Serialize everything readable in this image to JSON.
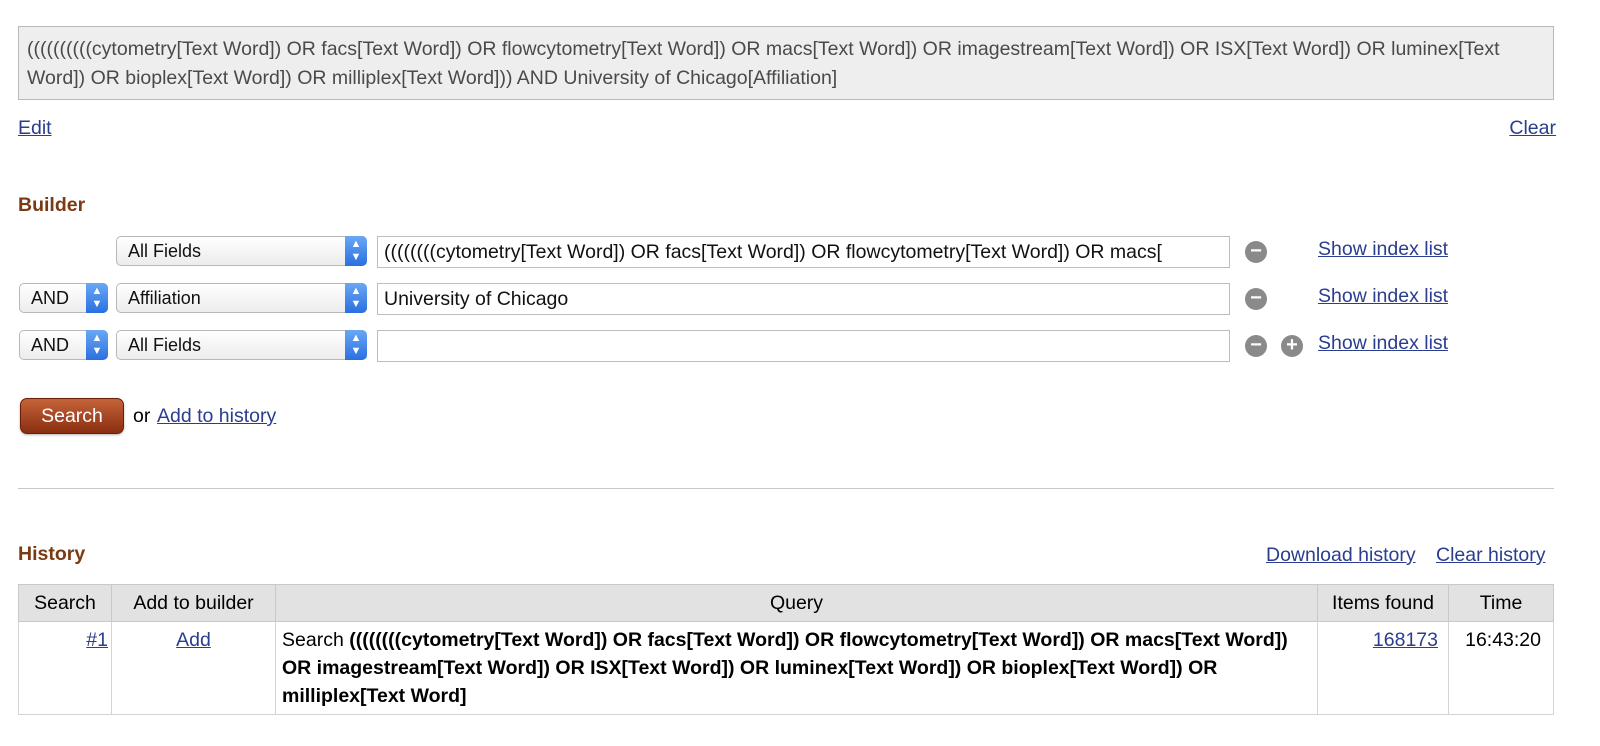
{
  "query_box": {
    "text": "((((((((((cytometry[Text Word]) OR facs[Text Word]) OR flowcytometry[Text Word]) OR macs[Text Word]) OR imagestream[Text Word]) OR ISX[Text Word]) OR luminex[Text Word]) OR bioplex[Text Word]) OR milliplex[Text Word])) AND University of Chicago[Affiliation]",
    "edit_label": "Edit",
    "clear_label": "Clear"
  },
  "builder": {
    "title": "Builder",
    "rows": [
      {
        "operator": "",
        "field": "All Fields",
        "value": "((((((((cytometry[Text Word]) OR facs[Text Word]) OR flowcytometry[Text Word]) OR macs[",
        "index_link": "Show index list"
      },
      {
        "operator": "AND",
        "field": "Affiliation",
        "value": "University of Chicago",
        "index_link": "Show index list"
      },
      {
        "operator": "AND",
        "field": "All Fields",
        "value": "",
        "index_link": "Show index list"
      }
    ],
    "search_label": "Search",
    "or_text": "or",
    "add_to_history_label": "Add to history"
  },
  "history": {
    "title": "History",
    "download_label": "Download history",
    "clear_label": "Clear history",
    "columns": [
      "Search",
      "Add to builder",
      "Query",
      "Items found",
      "Time"
    ],
    "rows": [
      {
        "search": "#1",
        "add": "Add",
        "query_prefix": "Search",
        "query": "((((((((cytometry[Text Word]) OR facs[Text Word]) OR flowcytometry[Text Word]) OR macs[Text Word]) OR imagestream[Text Word]) OR ISX[Text Word]) OR luminex[Text Word]) OR bioplex[Text Word]) OR milliplex[Text Word]",
        "items_found": "168173",
        "time": "16:43:20"
      }
    ]
  },
  "icons": {
    "remove": "minus-circle-icon",
    "add": "plus-circle-icon",
    "select_arrow": "updown-chevron-icon"
  },
  "colors": {
    "section_title": "#7a3a12",
    "link": "#2a3d8f",
    "search_button": "#8a2e10",
    "select_arrow": "#2a6fe0"
  }
}
